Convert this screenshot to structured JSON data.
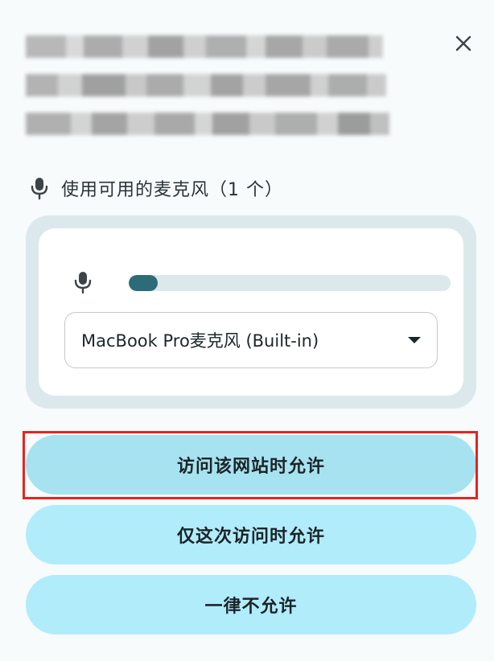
{
  "dialog": {
    "close_label": "×",
    "icons": {
      "close": "close-icon",
      "mic": "microphone-icon",
      "caret": "chevron-down-icon"
    },
    "colors": {
      "primary_button": "#a7e2f0",
      "secondary_button": "#b1ecfb",
      "level_fill": "#2e6b78",
      "highlight": "#e8231d"
    }
  },
  "microphone": {
    "available_label": "使用可用的麦克风（1 个）",
    "level_fraction": 0.09,
    "selected_device": "MacBook Pro麦克风 (Built-in)"
  },
  "actions": {
    "allow_site": "访问该网站时允许",
    "allow_once": "仅这次访问时允许",
    "never_allow": "一律不允许"
  }
}
